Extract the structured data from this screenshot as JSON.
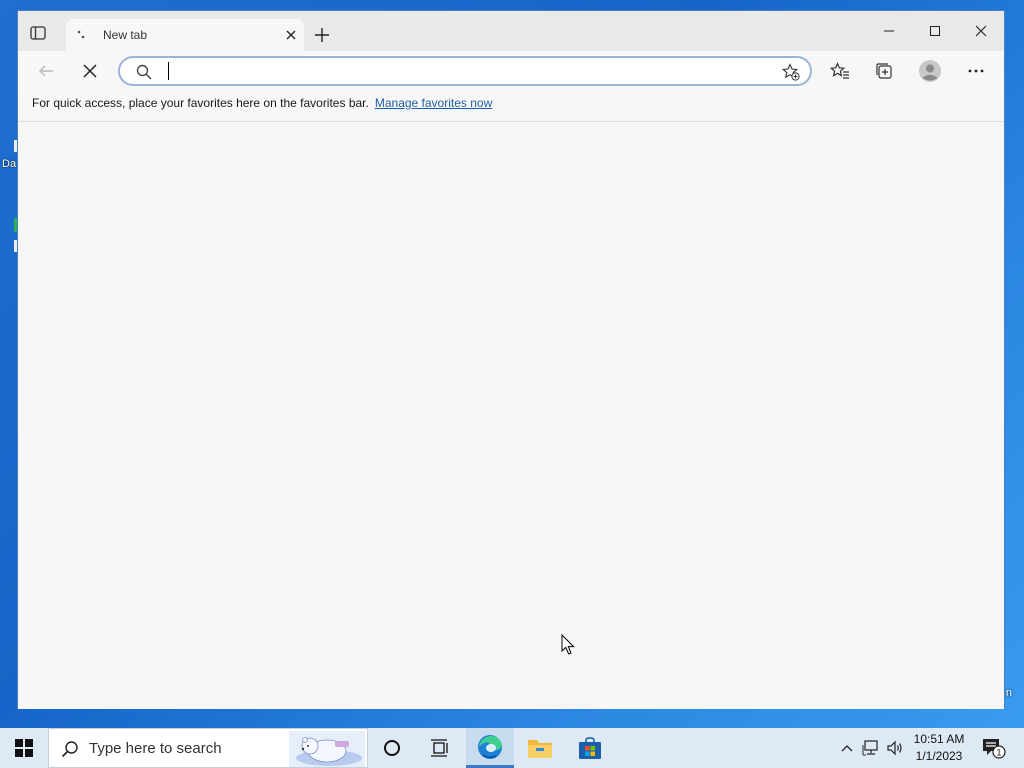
{
  "desktop": {
    "fragment_left": "Da",
    "fragment_right": "n"
  },
  "browser": {
    "tab": {
      "title": "New tab"
    },
    "address_bar": {
      "value": "",
      "placeholder": ""
    },
    "favorites_bar": {
      "message": "For quick access, place your favorites here on the favorites bar.",
      "link": "Manage favorites now"
    }
  },
  "taskbar": {
    "search_placeholder": "Type here to search",
    "apps": [
      "search",
      "cortana",
      "task-view",
      "edge",
      "file-explorer",
      "microsoft-store"
    ],
    "clock": {
      "time": "10:51 AM",
      "date": "1/1/2023"
    },
    "notification_count": "1"
  },
  "colors": {
    "accent": "#3c78c8",
    "link": "#1a5fa8",
    "desktop": "#1f6fd0",
    "taskbar": "#dde9f5"
  }
}
